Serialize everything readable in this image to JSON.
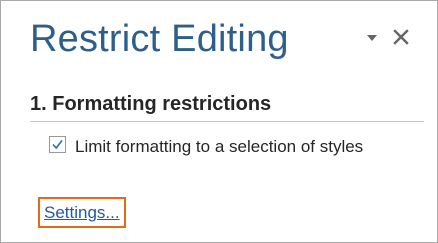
{
  "pane": {
    "title": "Restrict Editing",
    "options_icon": "dropdown-triangle-icon",
    "close_icon": "close-icon"
  },
  "formatting": {
    "heading": "1. Formatting restrictions",
    "limit_option": {
      "label": "Limit formatting to a selection of styles",
      "checked": true
    },
    "settings_link": "Settings..."
  },
  "colors": {
    "title": "#2e5f8a",
    "link": "#1d5b9c",
    "highlight_border": "#e36c1a",
    "check": "#2f6bb0",
    "icon": "#666666"
  }
}
